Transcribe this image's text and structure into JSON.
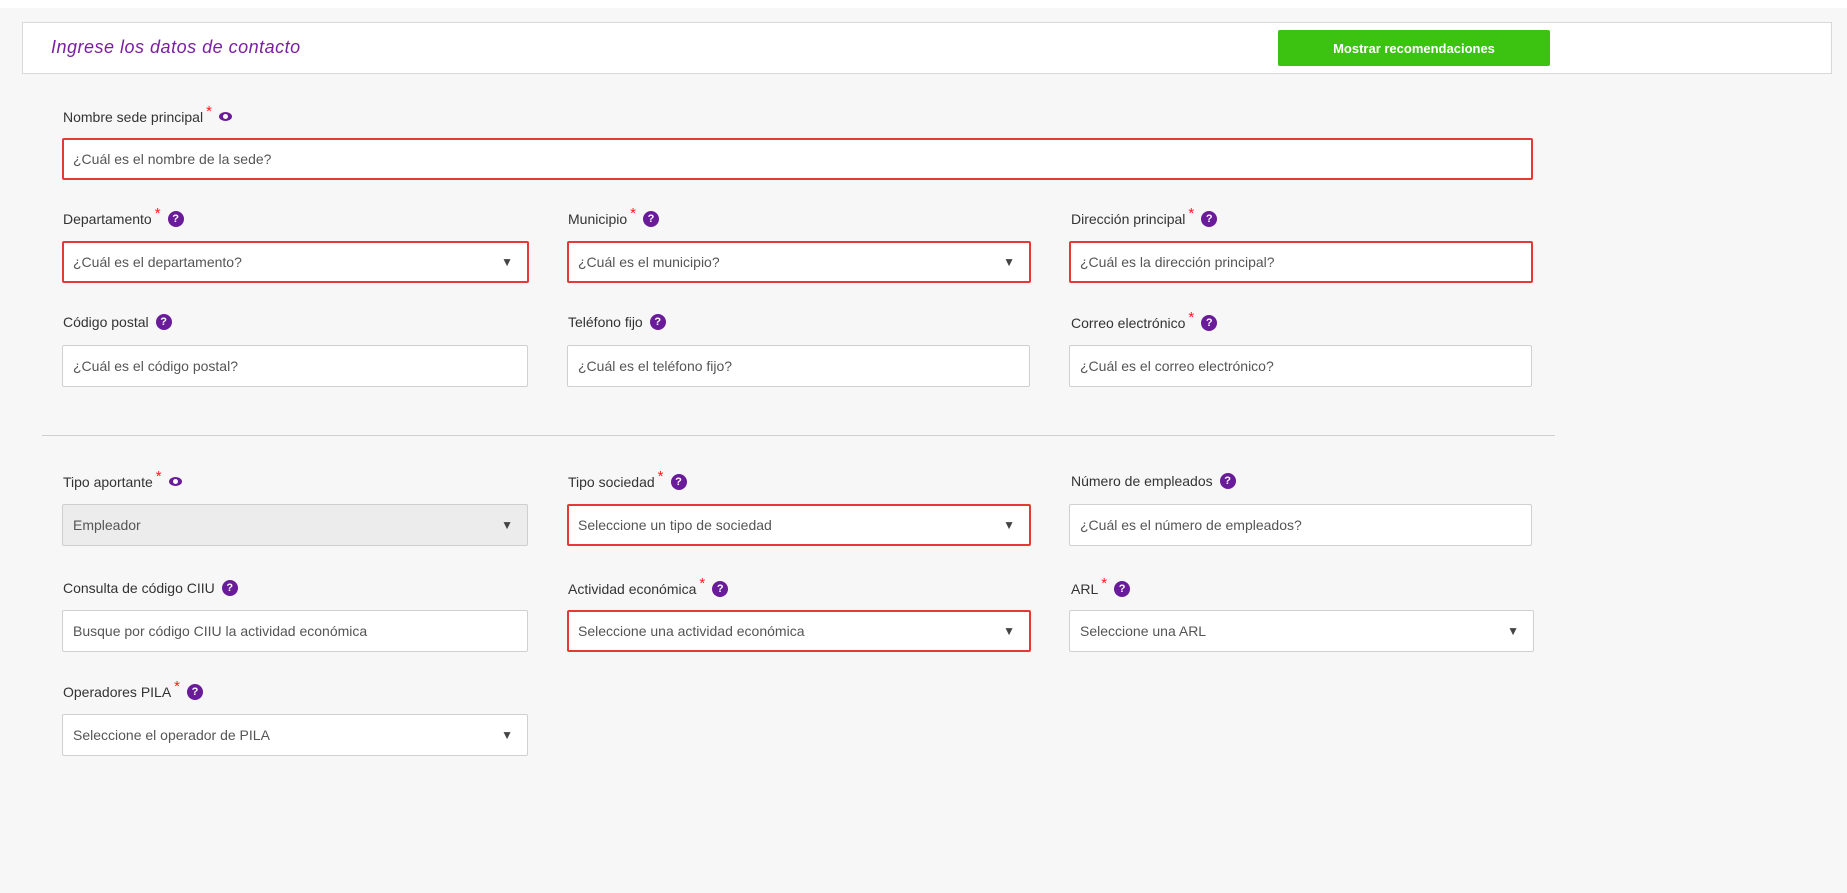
{
  "header": {
    "title": "Ingrese los datos de contacto",
    "recommend_button": "Mostrar recomendaciones"
  },
  "contact": {
    "sede": {
      "label": "Nombre sede principal",
      "placeholder": "¿Cuál es el nombre de la sede?"
    },
    "departamento": {
      "label": "Departamento",
      "placeholder": "¿Cuál es el departamento?"
    },
    "municipio": {
      "label": "Municipio",
      "placeholder": "¿Cuál es el municipio?"
    },
    "direccion": {
      "label": "Dirección principal",
      "placeholder": "¿Cuál es la dirección principal?"
    },
    "codigo_postal": {
      "label": "Código postal",
      "placeholder": "¿Cuál es el código postal?"
    },
    "telefono": {
      "label": "Teléfono fijo",
      "placeholder": "¿Cuál es el teléfono fijo?"
    },
    "correo": {
      "label": "Correo electrónico",
      "placeholder": "¿Cuál es el correo electrónico?"
    }
  },
  "company": {
    "tipo_aportante": {
      "label": "Tipo aportante",
      "value": "Empleador"
    },
    "tipo_sociedad": {
      "label": "Tipo sociedad",
      "value": "Seleccione un tipo de sociedad"
    },
    "numero_empleados": {
      "label": "Número de empleados",
      "placeholder": "¿Cuál es el número de empleados?"
    },
    "ciiu": {
      "label": "Consulta de código CIIU",
      "placeholder": "Busque por código CIIU la actividad económica"
    },
    "actividad": {
      "label": "Actividad económica",
      "value": "Seleccione una actividad económica"
    },
    "arl": {
      "label": "ARL",
      "value": "Seleccione una ARL"
    },
    "pila": {
      "label": "Operadores PILA",
      "value": "Seleccione el operador de PILA"
    }
  },
  "symbols": {
    "required": "*",
    "help": "?",
    "caret": "▼"
  },
  "colors": {
    "accent_purple": "#6a1b9a",
    "title_purple": "#7b1fa2",
    "button_green": "#3cc311",
    "error_red": "#e53935"
  },
  "icons": {
    "help": "question-circle-icon",
    "visibility": "eye-icon",
    "dropdown": "caret-down-icon"
  }
}
